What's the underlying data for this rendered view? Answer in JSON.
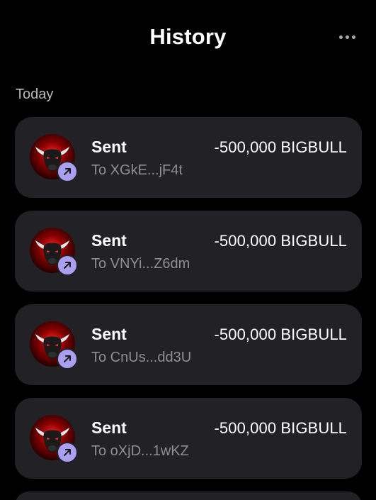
{
  "header": {
    "title": "History",
    "more_icon": "more-horizontal-icon"
  },
  "section": {
    "label": "Today"
  },
  "transactions": [
    {
      "type": "Sent",
      "to": "To XGkE...jF4t",
      "amount": "-500,000 BIGBULL"
    },
    {
      "type": "Sent",
      "to": "To VNYi...Z6dm",
      "amount": "-500,000 BIGBULL"
    },
    {
      "type": "Sent",
      "to": "To CnUs...dd3U",
      "amount": "-500,000 BIGBULL"
    },
    {
      "type": "Sent",
      "to": "To oXjD...1wKZ",
      "amount": "-500,000 BIGBULL"
    }
  ],
  "colors": {
    "background": "#000000",
    "card": "#222226",
    "accent": "#ab9ff2",
    "muted_text": "#8e8e93"
  },
  "icons": {
    "token": "bull-token-icon",
    "status": "arrow-up-right-icon"
  }
}
